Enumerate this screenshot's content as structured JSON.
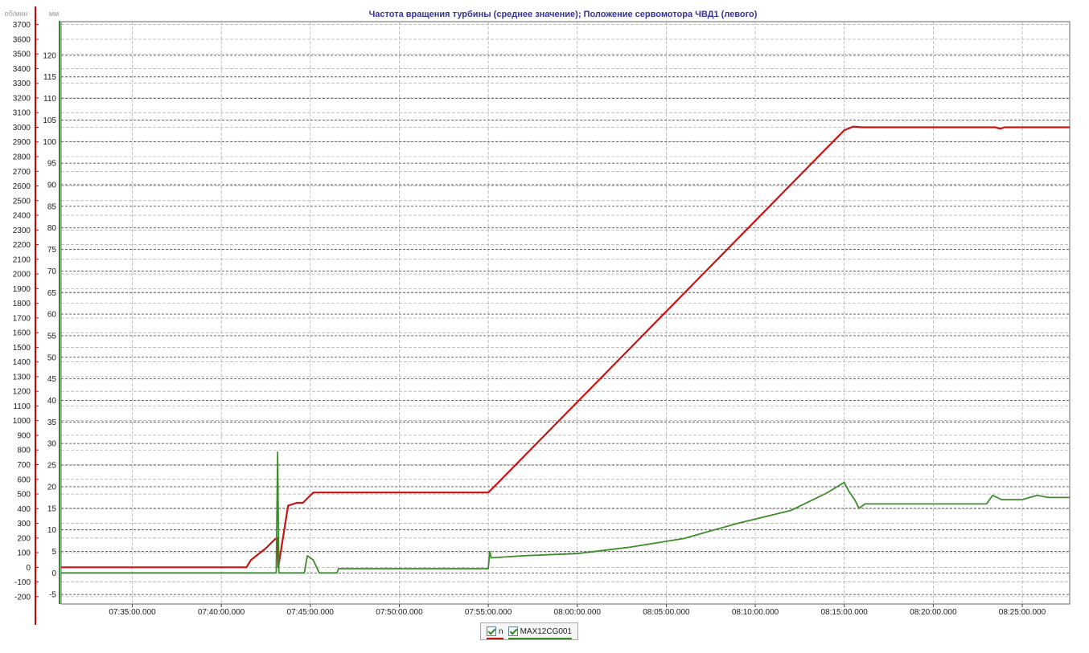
{
  "chart_data": {
    "type": "line",
    "title": "Частота вращения турбины (среднее значение); Положение сервомотора ЧВД1 (левого)",
    "title_color": "#333399",
    "left_axis": {
      "unit": "об/мин",
      "color": "#cc0000",
      "ylim": [
        -250,
        3720
      ],
      "ticks": [
        "-200",
        "-100",
        "0",
        "100",
        "200",
        "300",
        "400",
        "500",
        "600",
        "700",
        "800",
        "900",
        "1000",
        "1100",
        "1200",
        "1300",
        "1400",
        "1500",
        "1600",
        "1700",
        "1800",
        "1900",
        "2000",
        "2100",
        "2200",
        "2300",
        "2400",
        "2500",
        "2600",
        "2700",
        "2800",
        "2900",
        "3000",
        "3100",
        "3200",
        "3300",
        "3400",
        "3500",
        "3600",
        "3700"
      ]
    },
    "right_axis": {
      "unit": "мм",
      "color": "#2e8b2e",
      "ylim": [
        -7.2,
        127.8
      ],
      "ticks": [
        "-5",
        "0",
        "5",
        "10",
        "15",
        "20",
        "25",
        "30",
        "35",
        "40",
        "45",
        "50",
        "55",
        "60",
        "65",
        "70",
        "75",
        "80",
        "85",
        "90",
        "95",
        "100",
        "105",
        "110",
        "115",
        "120"
      ]
    },
    "x_axis": {
      "range": [
        "07:31:00",
        "08:27:40"
      ],
      "ticks": [
        "07:35:00.000",
        "07:40:00.000",
        "07:45:00.000",
        "07:50:00.000",
        "07:55:00.000",
        "08:00:00.000",
        "08:05:00.000",
        "08:10:00.000",
        "08:15:00.000",
        "08:20:00.000",
        "08:25:00.000"
      ]
    },
    "grid": true,
    "legend_position": "bottom-center",
    "series": [
      {
        "name": "n",
        "axis": "left",
        "color": "#cc1111",
        "x": [
          "07:31:00",
          "07:41:25",
          "07:41:40",
          "07:42:30",
          "07:43:00",
          "07:43:10",
          "07:43:12",
          "07:43:45",
          "07:44:15",
          "07:44:35",
          "07:45:10",
          "07:45:35",
          "07:55:00",
          "07:55:10",
          "08:15:00",
          "08:15:30",
          "08:16:00",
          "08:23:30",
          "08:23:45",
          "08:24:00",
          "08:27:40"
        ],
        "y": [
          0,
          0,
          50,
          130,
          190,
          200,
          0,
          420,
          440,
          440,
          510,
          510,
          510,
          530,
          2980,
          3005,
          3000,
          3000,
          2990,
          3000,
          3000
        ]
      },
      {
        "name": "MAX12CG001",
        "axis": "right",
        "color": "#3c8c2c",
        "x": [
          "07:31:00",
          "07:43:05",
          "07:43:10",
          "07:43:14",
          "07:43:18",
          "07:43:25",
          "07:44:40",
          "07:44:50",
          "07:45:10",
          "07:45:30",
          "07:46:30",
          "07:46:35",
          "07:55:00",
          "07:55:05",
          "07:55:10",
          "07:57:00",
          "08:00:00",
          "08:03:00",
          "08:06:00",
          "08:09:00",
          "08:12:00",
          "08:14:00",
          "08:15:00",
          "08:15:15",
          "08:15:35",
          "08:15:50",
          "08:16:10",
          "08:16:30",
          "08:20:00",
          "08:23:00",
          "08:23:20",
          "08:23:50",
          "08:25:00",
          "08:25:50",
          "08:26:30",
          "08:27:40"
        ],
        "y": [
          0,
          0,
          28,
          0,
          0,
          0,
          0,
          4,
          3,
          0,
          0,
          1,
          1,
          5,
          3.5,
          4,
          4.5,
          6,
          8,
          11.5,
          14.5,
          18.5,
          21,
          19,
          17,
          15,
          16,
          16,
          16,
          16,
          18,
          17,
          17,
          18,
          17.5,
          17.5
        ]
      }
    ]
  }
}
